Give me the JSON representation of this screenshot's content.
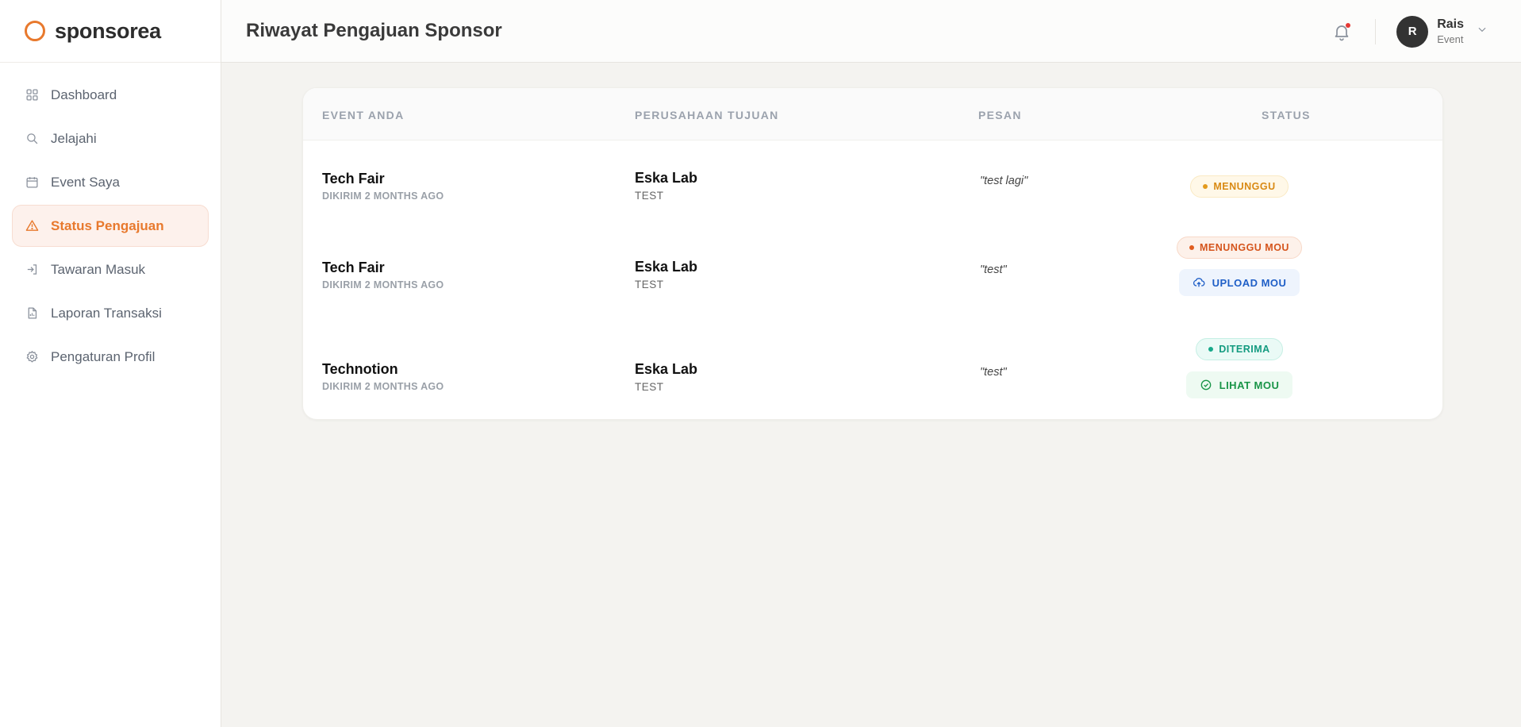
{
  "brand": {
    "name": "sponsorea"
  },
  "colors": {
    "accent": "#e8792d",
    "wait": "#d98a14",
    "mou": "#d5551d",
    "accepted": "#139b80",
    "upload": "#1f5fc7",
    "view": "#1a9548"
  },
  "sidebar": {
    "items": [
      {
        "label": "Dashboard",
        "icon": "grid-icon"
      },
      {
        "label": "Jelajahi",
        "icon": "search-icon"
      },
      {
        "label": "Event Saya",
        "icon": "calendar-icon"
      },
      {
        "label": "Status Pengajuan",
        "icon": "warning-triangle-icon",
        "active": true
      },
      {
        "label": "Tawaran Masuk",
        "icon": "login-icon"
      },
      {
        "label": "Laporan Transaksi",
        "icon": "document-chart-icon"
      },
      {
        "label": "Pengaturan Profil",
        "icon": "gear-icon"
      }
    ]
  },
  "header": {
    "title": "Riwayat Pengajuan Sponsor",
    "user": {
      "initial": "R",
      "name": "Rais",
      "role": "Event"
    }
  },
  "table": {
    "columns": [
      "EVENT ANDA",
      "PERUSAHAAN TUJUAN",
      "PESAN",
      "STATUS"
    ],
    "rows": [
      {
        "event": "Tech Fair",
        "sent": "DIKIRIM 2 MONTHS AGO",
        "company": "Eska Lab",
        "company_sub": "TEST",
        "message": "\"test lagi\"",
        "status": "MENUNGGU"
      },
      {
        "event": "Tech Fair",
        "sent": "DIKIRIM 2 MONTHS AGO",
        "company": "Eska Lab",
        "company_sub": "TEST",
        "message": "\"test\"",
        "status": "MENUNGGU MOU",
        "action": "UPLOAD MOU"
      },
      {
        "event": "Technotion",
        "sent": "DIKIRIM 2 MONTHS AGO",
        "company": "Eska Lab",
        "company_sub": "TEST",
        "message": "\"test\"",
        "status": "DITERIMA",
        "action": "LIHAT MOU"
      }
    ]
  }
}
